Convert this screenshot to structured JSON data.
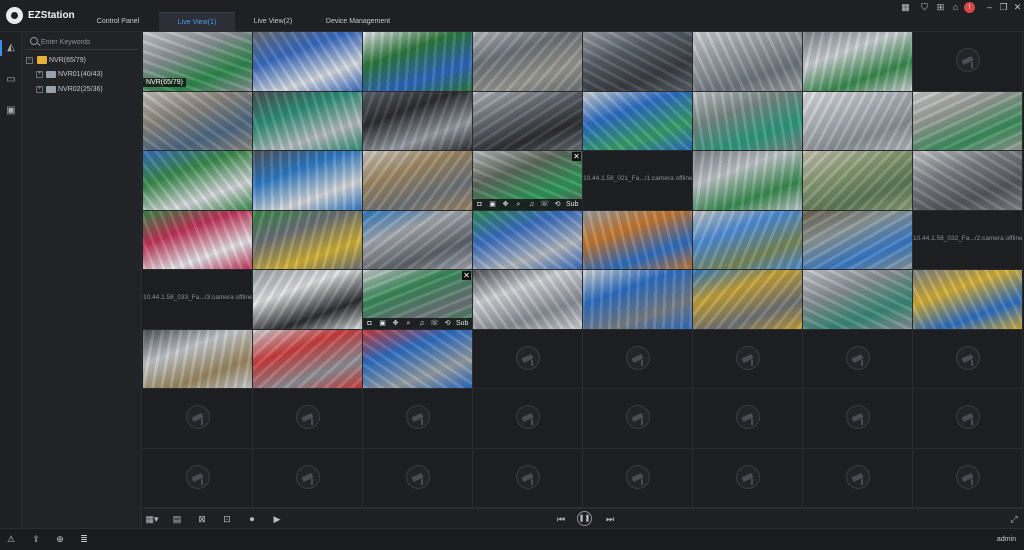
{
  "app": {
    "title": "EZStation"
  },
  "tabs": [
    {
      "label": "Control Panel",
      "active": false
    },
    {
      "label": "Live View(1)",
      "active": true
    },
    {
      "label": "Live View(2)",
      "active": false
    },
    {
      "label": "Device Management",
      "active": false
    }
  ],
  "titlebar_icons": [
    "layout-icon",
    "shirt-icon",
    "network-icon",
    "lock-icon",
    "alert-icon",
    "minimize-icon",
    "restore-icon",
    "close-icon"
  ],
  "sidebar": {
    "icons": [
      "camera-icon",
      "monitor-icon",
      "playback-icon"
    ],
    "search_placeholder": "Enter Keywords",
    "tree": [
      {
        "label": "NVR(65/79)",
        "level": 0,
        "type": "folder"
      },
      {
        "label": "NVR01(40/43)",
        "level": 1,
        "type": "nvr"
      },
      {
        "label": "NVR02(25/36)",
        "level": 1,
        "type": "nvr"
      }
    ]
  },
  "grid": {
    "columns": 8,
    "rows": 8,
    "selected_label": "NVR(65/79)",
    "toolbar_sub_label": "Sub",
    "tiles": [
      {
        "state": "live",
        "colors": [
          "#8e9499",
          "#2f8a4e",
          "#c9cdd1"
        ],
        "label": "NVR(65/79)"
      },
      {
        "state": "live",
        "colors": [
          "#3a6cc2",
          "#d9dde2",
          "#6b7078"
        ]
      },
      {
        "state": "live",
        "colors": [
          "#2f7a3e",
          "#2f68c0",
          "#e3e5e8"
        ]
      },
      {
        "state": "live",
        "colors": [
          "#6e7379",
          "#9b9a93",
          "#b8bcc0"
        ]
      },
      {
        "state": "live",
        "colors": [
          "#58606a",
          "#3a3d41",
          "#9da2a8"
        ]
      },
      {
        "state": "live",
        "colors": [
          "#9ea4aa",
          "#6e767e",
          "#d0d3d6"
        ]
      },
      {
        "state": "live",
        "colors": [
          "#cfd3d7",
          "#3a8a4e",
          "#7d848a"
        ]
      },
      {
        "state": "empty"
      },
      {
        "state": "live",
        "colors": [
          "#8d8880",
          "#4e6a84",
          "#c7c4bd"
        ]
      },
      {
        "state": "live",
        "colors": [
          "#2f8f7a",
          "#b9bec3",
          "#4d5258"
        ]
      },
      {
        "state": "live",
        "colors": [
          "#2b2d30",
          "#9aa0a6",
          "#5e6268"
        ]
      },
      {
        "state": "live",
        "colors": [
          "#6a6f75",
          "#2b2d30",
          "#b6bbc0"
        ]
      },
      {
        "state": "live",
        "colors": [
          "#2e6fc6",
          "#3aa06a",
          "#cfd3d7"
        ]
      },
      {
        "state": "live",
        "colors": [
          "#7b8a86",
          "#2f9b80",
          "#c1c6ca"
        ]
      },
      {
        "state": "live",
        "colors": [
          "#b7bcc1",
          "#8c9298",
          "#e0e2e4"
        ]
      },
      {
        "state": "live",
        "colors": [
          "#9b9f9a",
          "#3d8f5e",
          "#cdd0cf"
        ]
      },
      {
        "state": "live",
        "colors": [
          "#3b8c4e",
          "#d8dbde",
          "#3a6fc0"
        ]
      },
      {
        "state": "live",
        "colors": [
          "#2f7bc6",
          "#d8dadc",
          "#4f555c"
        ]
      },
      {
        "state": "live",
        "colors": [
          "#a08a66",
          "#6f7479",
          "#cfcac1"
        ]
      },
      {
        "state": "toolbar",
        "colors": [
          "#5f6b5e",
          "#2e9a5a",
          "#b7bbbf"
        ]
      },
      {
        "state": "offline",
        "text": "10.44.1.58_021_Fa.../1:camera offline"
      },
      {
        "state": "live",
        "colors": [
          "#c3c8cc",
          "#3a8c52",
          "#7a8087"
        ]
      },
      {
        "state": "live",
        "colors": [
          "#8ea07a",
          "#5e7a56",
          "#c8c4b4"
        ]
      },
      {
        "state": "live",
        "colors": [
          "#7e8286",
          "#56595d",
          "#c7c9cb"
        ]
      },
      {
        "state": "live",
        "colors": [
          "#c2345a",
          "#e6e7e9",
          "#3b8a4b"
        ]
      },
      {
        "state": "live",
        "colors": [
          "#6d7278",
          "#d3b43a",
          "#3b8a4b"
        ]
      },
      {
        "state": "live",
        "colors": [
          "#a8acb1",
          "#5f646a",
          "#2f7bc6"
        ]
      },
      {
        "state": "live",
        "colors": [
          "#3c6fc3",
          "#b5bac0",
          "#2f8d5a"
        ]
      },
      {
        "state": "live",
        "colors": [
          "#c87a32",
          "#2e6fc4",
          "#9ba0a6"
        ]
      },
      {
        "state": "live",
        "colors": [
          "#4f8ed8",
          "#7c8a5a",
          "#c7c9c4"
        ]
      },
      {
        "state": "live",
        "colors": [
          "#8f9b9c",
          "#3a7bc8",
          "#6d6552"
        ]
      },
      {
        "state": "offline",
        "text": "10.44.1.58_032_Fa.../2:camera offline"
      },
      {
        "state": "offline",
        "text": "10.44.1.58_033_Fa.../3:camera offline"
      },
      {
        "state": "live",
        "colors": [
          "#e2e4e6",
          "#2a2c2f",
          "#9b9fa4"
        ]
      },
      {
        "state": "toolbar",
        "colors": [
          "#3a8a5a",
          "#6f767c",
          "#c9cdd1"
        ]
      },
      {
        "state": "live",
        "colors": [
          "#d3d6d9",
          "#8b9096",
          "#4e5358"
        ]
      },
      {
        "state": "live",
        "colors": [
          "#2e6fc4",
          "#7a8087",
          "#cfd3d7"
        ]
      },
      {
        "state": "live",
        "colors": [
          "#c9a43a",
          "#6d7378",
          "#2f7bc6"
        ]
      },
      {
        "state": "live",
        "colors": [
          "#8c9298",
          "#3a8a7a",
          "#c7cacd"
        ]
      },
      {
        "state": "live",
        "colors": [
          "#d7b23a",
          "#2e6fc4",
          "#7b8187"
        ]
      },
      {
        "state": "live",
        "colors": [
          "#c8ccd0",
          "#9b8862",
          "#4e5359"
        ]
      },
      {
        "state": "live",
        "colors": [
          "#cc3e3e",
          "#8e9399",
          "#d3d6d9"
        ]
      },
      {
        "state": "live",
        "colors": [
          "#2e6fc4",
          "#9aa0a6",
          "#cc3e3e"
        ]
      },
      {
        "state": "empty"
      },
      {
        "state": "empty"
      },
      {
        "state": "empty"
      },
      {
        "state": "empty"
      },
      {
        "state": "empty"
      },
      {
        "state": "empty"
      },
      {
        "state": "empty"
      },
      {
        "state": "empty"
      },
      {
        "state": "empty"
      },
      {
        "state": "empty"
      },
      {
        "state": "empty"
      },
      {
        "state": "empty"
      },
      {
        "state": "empty"
      },
      {
        "state": "empty"
      },
      {
        "state": "empty"
      },
      {
        "state": "empty"
      },
      {
        "state": "empty"
      },
      {
        "state": "empty"
      },
      {
        "state": "empty"
      },
      {
        "state": "empty"
      },
      {
        "state": "empty"
      }
    ]
  },
  "bottom_toolbar": {
    "icons": [
      "split-screen-icon",
      "view-layout-icon",
      "close-all-icon",
      "snapshot-icon",
      "record-icon",
      "video-icon"
    ],
    "playback_icons": [
      "previous-icon",
      "pause-icon",
      "next-icon"
    ],
    "right_icon": "fullscreen-icon"
  },
  "statusbar": {
    "icons": [
      "warning-icon",
      "export-icon",
      "download-icon",
      "log-icon"
    ],
    "user": "admin"
  }
}
